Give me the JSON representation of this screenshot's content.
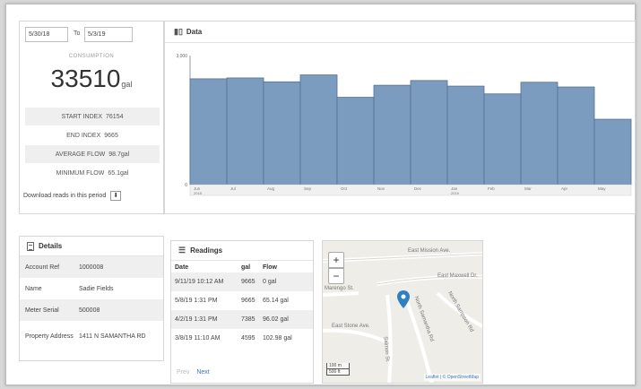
{
  "consumption": {
    "date_from": "5/30/18",
    "date_to_label": "To",
    "date_to": "5/3/19",
    "caption": "CONSUMPTION",
    "value": "33510",
    "unit": "gal",
    "stats": [
      {
        "label": "START INDEX",
        "value": "76154"
      },
      {
        "label": "END INDEX",
        "value": "9665"
      },
      {
        "label": "AVERAGE FLOW",
        "value": "98.7gal"
      },
      {
        "label": "MINIMUM FLOW",
        "value": "65.1gal"
      }
    ],
    "download_label": "Download reads in this period"
  },
  "chart": {
    "title": "Data",
    "icon": "bar-chart-icon"
  },
  "chart_data": {
    "type": "bar",
    "ylim": [
      0,
      3000
    ],
    "yticks": [
      "3,000",
      "0"
    ],
    "categories": [
      "Jun",
      "Jul",
      "Aug",
      "Sep",
      "Oct",
      "Nov",
      "Dec",
      "Jan",
      "Feb",
      "Mar",
      "Apr",
      "May"
    ],
    "year_labels": {
      "Jun": "2018",
      "Jan": "2019"
    },
    "values": [
      2460,
      2480,
      2390,
      2550,
      2030,
      2310,
      2420,
      2290,
      2110,
      2380,
      2270,
      1520
    ],
    "bar_color": "#7b9bbf",
    "grid": false
  },
  "details": {
    "title": "Details",
    "rows": [
      {
        "key": "Account Ref",
        "value": "1000008"
      },
      {
        "key": "Name",
        "value": "Sadie Fields"
      },
      {
        "key": "Meter Serial",
        "value": "500008"
      },
      {
        "key": "Property Address",
        "value": "1411 N SAMANTHA RD"
      }
    ]
  },
  "readings": {
    "title": "Readings",
    "columns": [
      "Date",
      "gal",
      "Flow"
    ],
    "rows": [
      {
        "date": "9/11/19 10:12 AM",
        "gal": "9665",
        "flow": "0 gal"
      },
      {
        "date": "5/8/19 1:31 PM",
        "gal": "9665",
        "flow": "65.14 gal"
      },
      {
        "date": "4/2/19 1:31 PM",
        "gal": "7385",
        "flow": "96.02 gal"
      },
      {
        "date": "3/8/19 11:10 AM",
        "gal": "4595",
        "flow": "102.98 gal"
      }
    ],
    "prev_label": "Prev",
    "next_label": "Next"
  },
  "map": {
    "zoom_in": "+",
    "zoom_out": "−",
    "streets": [
      "East Mission Ave.",
      "East Maxwell Dr.",
      "North Sampson Rd",
      "Marengo St.",
      "East Stone Ave.",
      "Salmon St.",
      "North Samantha Rd"
    ],
    "scale_m": "100 m",
    "scale_ft": "500 ft",
    "attribution": "Leaflet | © OpenStreetMap",
    "pin_color": "#2f7fc2"
  }
}
